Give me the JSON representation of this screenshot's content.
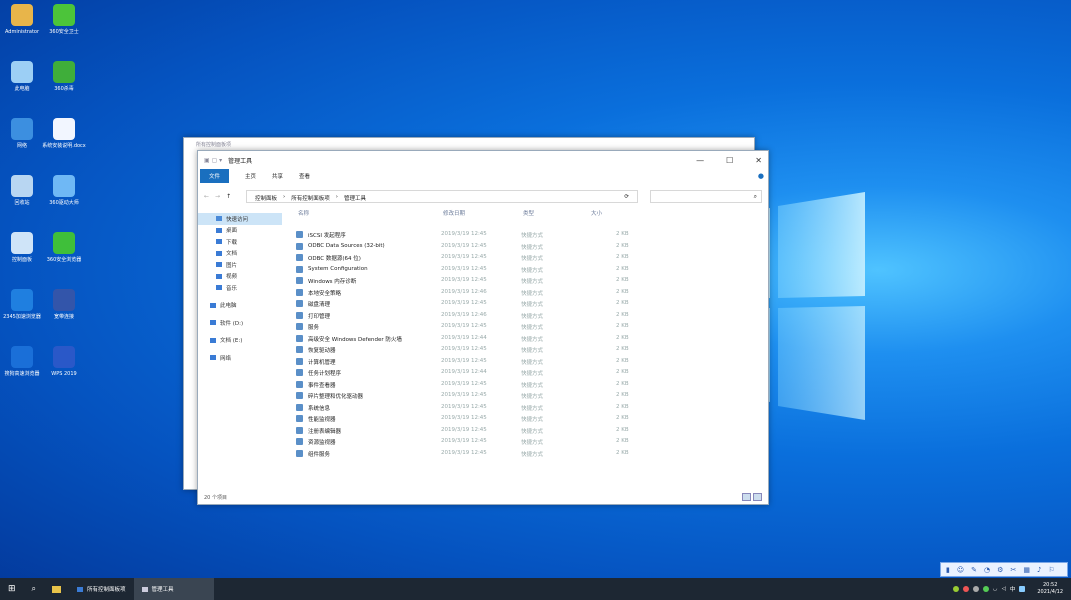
{
  "desktop_icons": [
    {
      "label": "Administrator",
      "color": "#e8b54a"
    },
    {
      "label": "360安全卫士",
      "color": "#4cc43a"
    },
    {
      "label": "此电脑",
      "color": "#9ccff5"
    },
    {
      "label": "360杀毒",
      "color": "#3fae3a"
    },
    {
      "label": "网络",
      "color": "#3c8fe0"
    },
    {
      "label": "系统安装说明.docx",
      "color": "#f2f6ff"
    },
    {
      "label": "回收站",
      "color": "#b8d6f2"
    },
    {
      "label": "360驱动大师",
      "color": "#6fb8f5"
    },
    {
      "label": "控制面板",
      "color": "#cfe4f8"
    },
    {
      "label": "360安全浏览器",
      "color": "#3fbf3a"
    },
    {
      "label": "2345加速浏览器",
      "color": "#1f7fe0"
    },
    {
      "label": "宽带连接",
      "color": "#3355aa"
    },
    {
      "label": "搜狗高速浏览器",
      "color": "#1a6fd8"
    },
    {
      "label": "WPS 2019",
      "color": "#2a58c8"
    }
  ],
  "back_window": {
    "title": "所有控制面板项"
  },
  "window": {
    "title": "管理工具",
    "controls": {
      "minimize": "—",
      "maximize": "☐",
      "close": "✕"
    },
    "ribbon_tabs": [
      "文件",
      "主页",
      "共享",
      "查看"
    ],
    "breadcrumb": [
      "控制面板",
      "所有控制面板项",
      "管理工具"
    ],
    "search_placeholder": "⌕",
    "sidebar": [
      "快速访问",
      "桌面",
      "下载",
      "文档",
      "图片",
      "视频",
      "音乐",
      "此电脑",
      "软件 (D:)",
      "文档 (E:)",
      "网络"
    ],
    "columns": [
      "名称",
      "修改日期",
      "类型",
      "大小"
    ],
    "files": [
      {
        "name": "iSCSI 发起程序",
        "date": "2019/3/19 12:45",
        "type": "快捷方式",
        "size": "2 KB"
      },
      {
        "name": "ODBC Data Sources (32-bit)",
        "date": "2019/3/19 12:45",
        "type": "快捷方式",
        "size": "2 KB"
      },
      {
        "name": "ODBC 数据源(64 位)",
        "date": "2019/3/19 12:45",
        "type": "快捷方式",
        "size": "2 KB"
      },
      {
        "name": "System Configuration",
        "date": "2019/3/19 12:45",
        "type": "快捷方式",
        "size": "2 KB"
      },
      {
        "name": "Windows 内存诊断",
        "date": "2019/3/19 12:45",
        "type": "快捷方式",
        "size": "2 KB"
      },
      {
        "name": "本地安全策略",
        "date": "2019/3/19 12:46",
        "type": "快捷方式",
        "size": "2 KB"
      },
      {
        "name": "磁盘清理",
        "date": "2019/3/19 12:45",
        "type": "快捷方式",
        "size": "2 KB"
      },
      {
        "name": "打印管理",
        "date": "2019/3/19 12:46",
        "type": "快捷方式",
        "size": "2 KB"
      },
      {
        "name": "服务",
        "date": "2019/3/19 12:45",
        "type": "快捷方式",
        "size": "2 KB"
      },
      {
        "name": "高级安全 Windows Defender 防火墙",
        "date": "2019/3/19 12:44",
        "type": "快捷方式",
        "size": "2 KB"
      },
      {
        "name": "恢复驱动器",
        "date": "2019/3/19 12:45",
        "type": "快捷方式",
        "size": "2 KB"
      },
      {
        "name": "计算机管理",
        "date": "2019/3/19 12:45",
        "type": "快捷方式",
        "size": "2 KB"
      },
      {
        "name": "任务计划程序",
        "date": "2019/3/19 12:44",
        "type": "快捷方式",
        "size": "2 KB"
      },
      {
        "name": "事件查看器",
        "date": "2019/3/19 12:45",
        "type": "快捷方式",
        "size": "2 KB"
      },
      {
        "name": "碎片整理和优化驱动器",
        "date": "2019/3/19 12:45",
        "type": "快捷方式",
        "size": "2 KB"
      },
      {
        "name": "系统信息",
        "date": "2019/3/19 12:45",
        "type": "快捷方式",
        "size": "2 KB"
      },
      {
        "name": "性能监视器",
        "date": "2019/3/19 12:45",
        "type": "快捷方式",
        "size": "2 KB"
      },
      {
        "name": "注册表编辑器",
        "date": "2019/3/19 12:45",
        "type": "快捷方式",
        "size": "2 KB"
      },
      {
        "name": "资源监视器",
        "date": "2019/3/19 12:45",
        "type": "快捷方式",
        "size": "2 KB"
      },
      {
        "name": "组件服务",
        "date": "2019/3/19 12:45",
        "type": "快捷方式",
        "size": "2 KB"
      }
    ],
    "status": "20 个项目"
  },
  "taskbar": {
    "items": [
      "所有控制面板项",
      "管理工具"
    ],
    "time": "20:52",
    "date": "2021/4/12"
  }
}
